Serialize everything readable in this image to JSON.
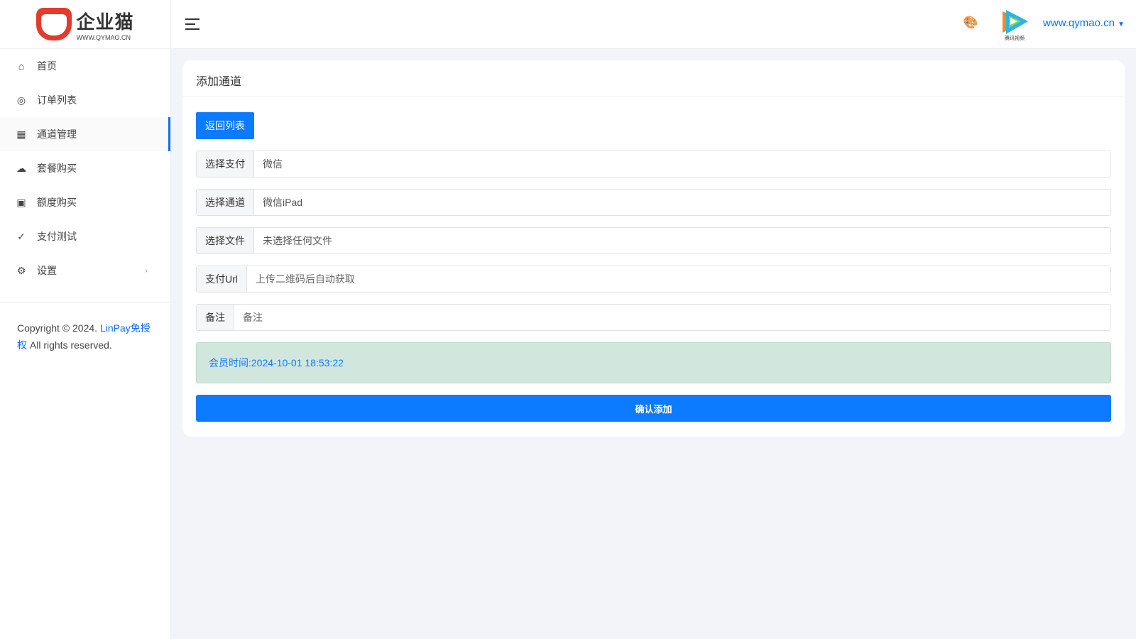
{
  "logo": {
    "name": "企业猫",
    "url": "WWW.QYMAO.CN"
  },
  "sidebar": {
    "items": [
      {
        "label": "首页",
        "icon": "home-icon",
        "glyph": "⌂"
      },
      {
        "label": "订单列表",
        "icon": "target-icon",
        "glyph": "◎"
      },
      {
        "label": "通道管理",
        "icon": "qrcode-icon",
        "glyph": "▦"
      },
      {
        "label": "套餐购买",
        "icon": "cloud-icon",
        "glyph": "☁"
      },
      {
        "label": "额度购买",
        "icon": "money-icon",
        "glyph": "▣"
      },
      {
        "label": "支付测试",
        "icon": "check-circle-icon",
        "glyph": "✓"
      },
      {
        "label": "设置",
        "icon": "gear-icon",
        "glyph": "⚙",
        "chevron": "›"
      }
    ]
  },
  "footer": {
    "prefix": "Copyright © 2024. ",
    "link": "LinPay免授权",
    "suffix": " All rights reserved."
  },
  "header": {
    "user": "www.qymao.cn",
    "palette_glyph": "🎨",
    "avatar_text": "腾讯视频"
  },
  "card": {
    "title": "添加通道",
    "back_label": "返回列表",
    "fields": [
      {
        "label": "选择支付",
        "value": "微信"
      },
      {
        "label": "选择通道",
        "value": "微信iPad"
      },
      {
        "label": "选择文件",
        "value": "未选择任何文件"
      },
      {
        "label": "支付Url",
        "placeholder": "上传二维码后自动获取"
      },
      {
        "label": "备注",
        "placeholder": "备注"
      }
    ],
    "member_time": "会员时间:2024-10-01 18:53:22",
    "submit_label": "确认添加"
  },
  "colors": {
    "primary": "#0d7bff",
    "alert_bg": "#d1e7dd"
  }
}
